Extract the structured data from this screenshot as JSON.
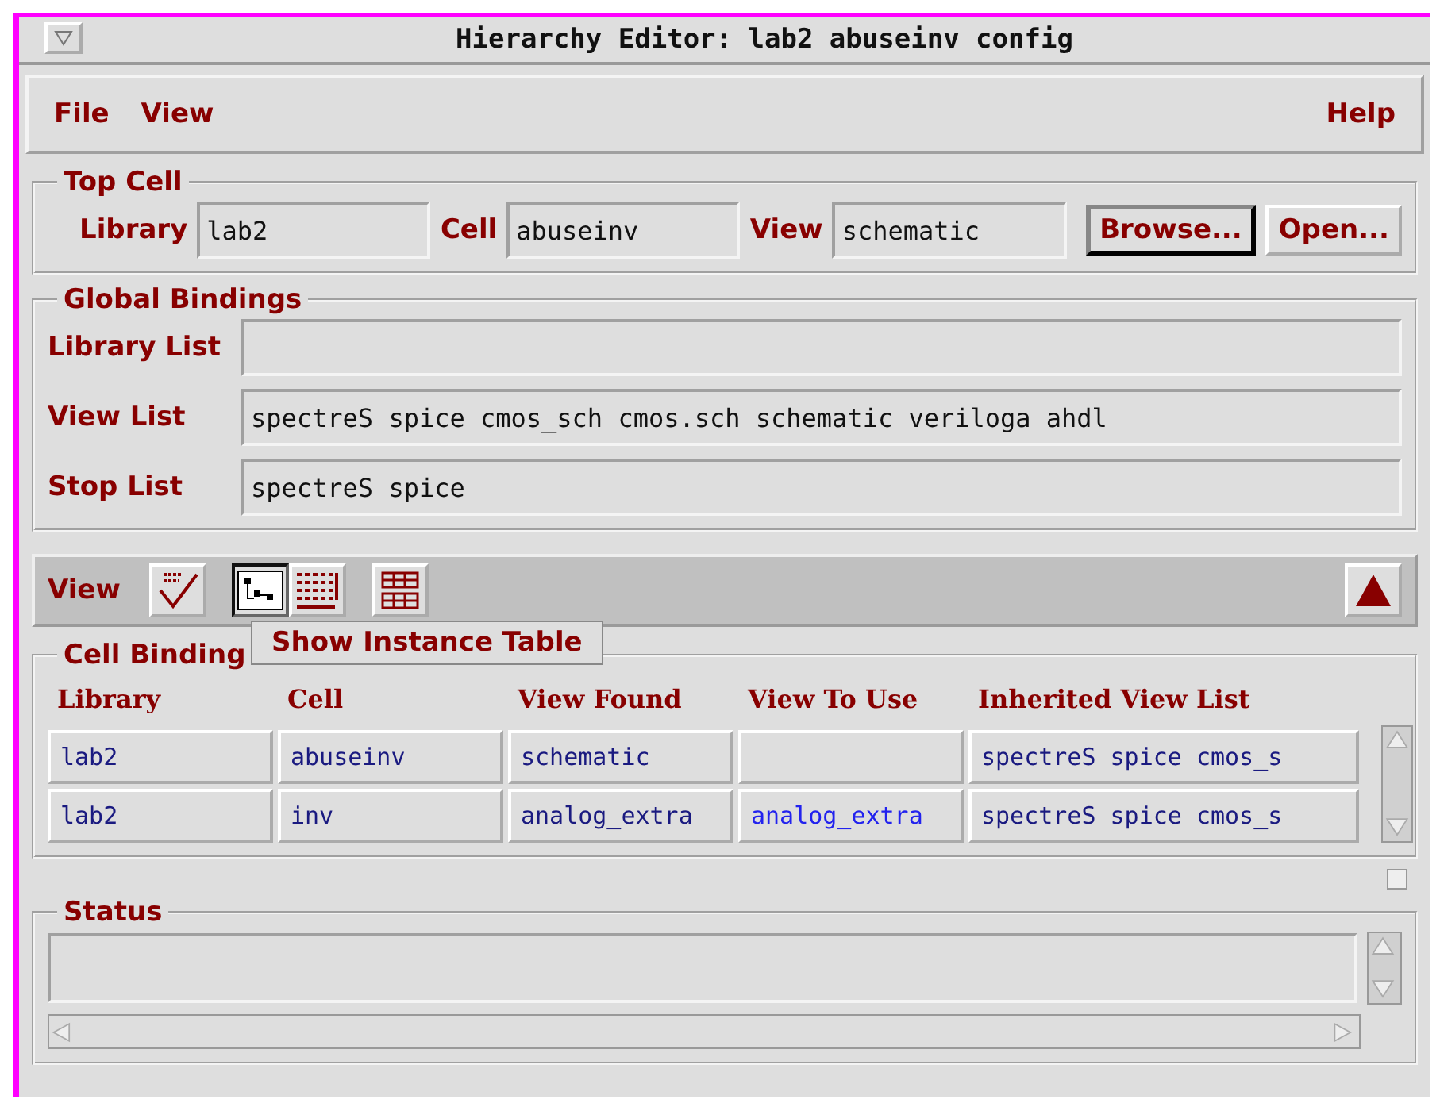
{
  "window": {
    "title": "Hierarchy Editor: lab2 abuseinv config"
  },
  "menu": {
    "left": [
      "File",
      "View"
    ],
    "right": "Help"
  },
  "top_cell": {
    "title": "Top Cell",
    "fields": [
      {
        "label": "Library",
        "value": "lab2"
      },
      {
        "label": "Cell",
        "value": "abuseinv"
      },
      {
        "label": "View",
        "value": "schematic"
      }
    ],
    "buttons": [
      {
        "label": "Browse...",
        "selected": true
      },
      {
        "label": "Open...",
        "selected": false
      }
    ]
  },
  "global_bindings": {
    "title": "Global Bindings",
    "fields": [
      {
        "label": "Library List"
      },
      {
        "label": "View List",
        "value": "spectreS spice cmos_sch cmos.sch schematic veriloga ahdl"
      },
      {
        "label": "Stop List",
        "value": "spectreS spice"
      }
    ]
  },
  "view_toolbar": {
    "label": "View",
    "tools": [
      {
        "kind": "check",
        "selected": false
      },
      {
        "kind": "tree",
        "selected": true
      },
      {
        "kind": "instances",
        "selected": false
      },
      {
        "kind": "table",
        "selected": false
      }
    ],
    "tooltip": "Show Instance Table"
  },
  "cell_bindings": {
    "title": "Cell Binding",
    "columns": [
      "Library",
      "Cell",
      "View Found",
      "View To Use",
      "Inherited View List"
    ],
    "rows": [
      [
        "lab2",
        "abuseinv",
        "schematic",
        "",
        "spectreS spice cmos_s"
      ],
      [
        "lab2",
        "inv",
        "analog_extra",
        "analog_extra",
        "spectreS spice cmos_s"
      ]
    ]
  },
  "status": {
    "title": "Status"
  }
}
